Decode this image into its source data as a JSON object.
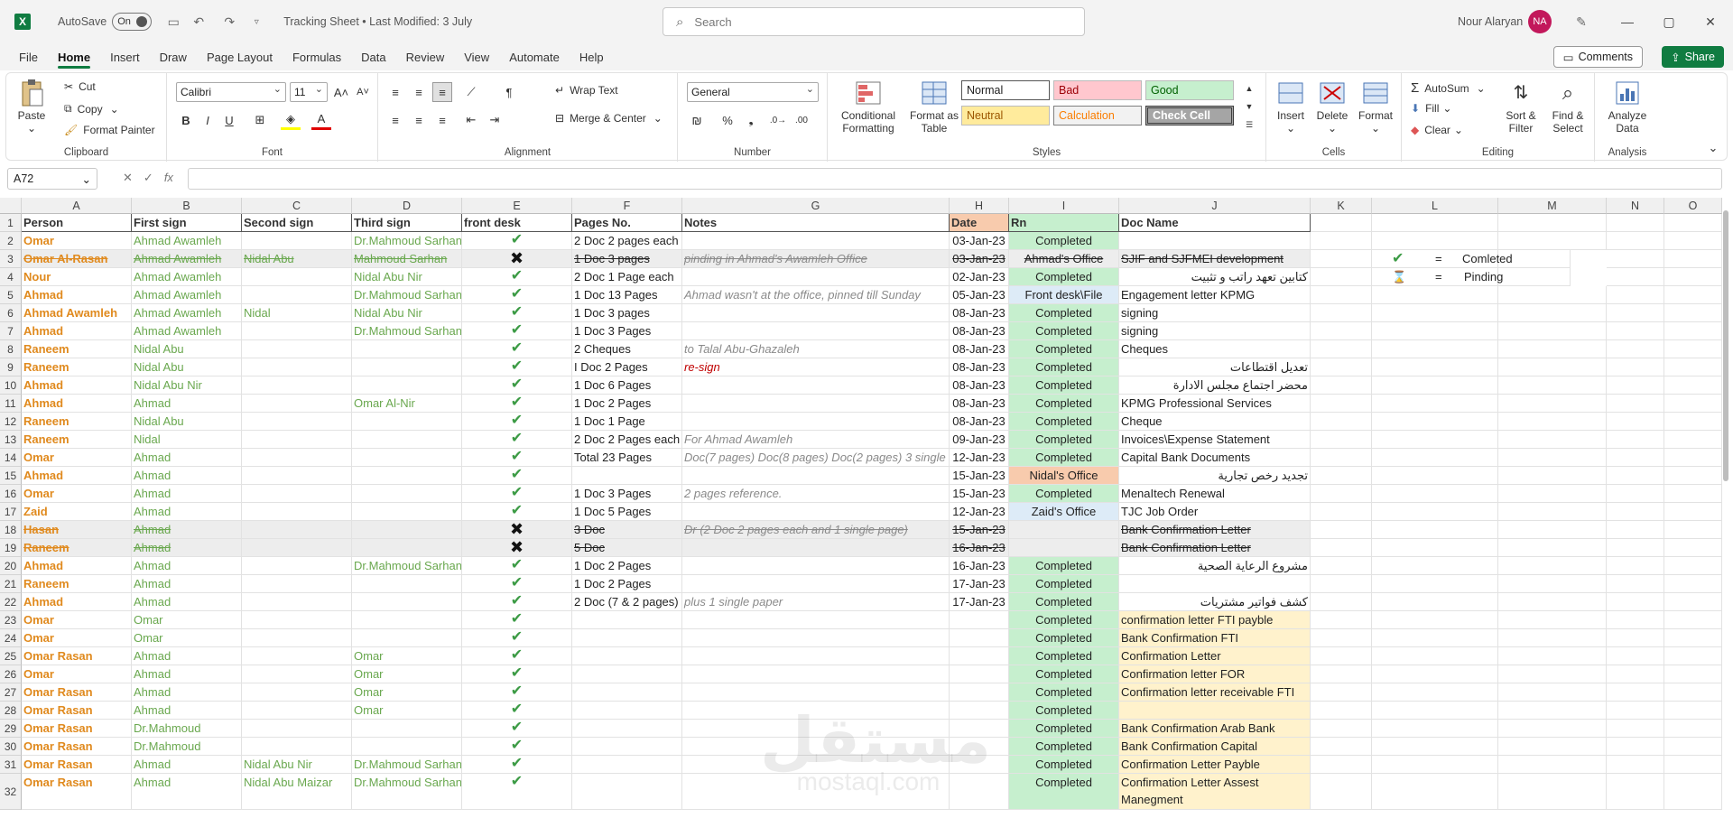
{
  "titlebar": {
    "autosave_label": "AutoSave",
    "autosave_state": "On",
    "doc_title": "Tracking Sheet • Last Modified: 3 July",
    "search_placeholder": "Search",
    "user_name": "Nour Alaryan",
    "user_initials": "NA"
  },
  "menu": {
    "tabs": [
      "File",
      "Home",
      "Insert",
      "Draw",
      "Page Layout",
      "Formulas",
      "Data",
      "Review",
      "View",
      "Automate",
      "Help"
    ],
    "comments": "Comments",
    "share": "Share"
  },
  "ribbon": {
    "clipboard": {
      "paste": "Paste",
      "cut": "Cut",
      "copy": "Copy",
      "format_painter": "Format Painter",
      "label": "Clipboard"
    },
    "font": {
      "name": "Calibri",
      "size": "11",
      "label": "Font"
    },
    "alignment": {
      "wrap": "Wrap Text",
      "merge": "Merge & Center",
      "label": "Alignment"
    },
    "number": {
      "format": "General",
      "label": "Number"
    },
    "styles": {
      "cond": "Conditional Formatting",
      "table": "Format as Table",
      "normal": "Normal",
      "bad": "Bad",
      "good": "Good",
      "neutral": "Neutral",
      "calculation": "Calculation",
      "check": "Check Cell",
      "label": "Styles"
    },
    "cells": {
      "insert": "Insert",
      "delete": "Delete",
      "format": "Format",
      "label": "Cells"
    },
    "editing": {
      "autosum": "AutoSum",
      "fill": "Fill",
      "clear": "Clear",
      "sort": "Sort & Filter",
      "find": "Find & Select",
      "label": "Editing"
    },
    "analysis": {
      "analyze": "Analyze Data",
      "label": "Analysis"
    }
  },
  "formula": {
    "namebox": "A72",
    "fx": "fx"
  },
  "columns": [
    "A",
    "B",
    "C",
    "D",
    "E",
    "F",
    "G",
    "H",
    "I",
    "J",
    "K",
    "L",
    "M",
    "N",
    "O"
  ],
  "headers": {
    "a": "Person",
    "b": "First sign",
    "c": "Second sign",
    "d": "Third sign",
    "e": "front desk",
    "f": "Pages No.",
    "g": "Notes",
    "h": "Date",
    "i": "Rn",
    "j": "Doc Name"
  },
  "legend": {
    "completed": "Comleted",
    "pending": "Pinding",
    "eq": "="
  },
  "rows": [
    {
      "n": "2",
      "a": "Omar",
      "b": "Ahmad Awamleh",
      "d": "Dr.Mahmoud Sarhan",
      "e": "check",
      "f": "2 Doc 2 pages each",
      "g": "",
      "h": "03-Jan-23",
      "i": "Completed",
      "j": ""
    },
    {
      "n": "3",
      "a": "Omar Al-Rasan",
      "b": "Ahmad Awamleh",
      "c": "Nidal Abu",
      "d": "Mahmoud Sarhan",
      "e": "x",
      "f": "1 Doc 3 pages",
      "g": "pinding in Ahmad's Awamleh Office",
      "h": "03-Jan-23",
      "i": "Ahmad's Office",
      "j": "SJIF and SJFMEI development",
      "strike": true
    },
    {
      "n": "4",
      "a": "Nour",
      "b": "Ahmad Awamleh",
      "d": "Nidal Abu Nir",
      "e": "check",
      "f": "2 Doc 1 Page each",
      "g": "",
      "h": "02-Jan-23",
      "i": "Completed",
      "j": "كتابين تعهد راتب و تثبيت"
    },
    {
      "n": "5",
      "a": "Ahmad",
      "b": "Ahmad Awamleh",
      "d": "Dr.Mahmoud Sarhan",
      "e": "check",
      "f": "1 Doc 13 Pages",
      "g": "Ahmad wasn't at the office, pinned till Sunday",
      "h": "05-Jan-23",
      "i": "Front desk\\File",
      "j": "Engagement letter KPMG"
    },
    {
      "n": "6",
      "a": "Ahmad Awamleh",
      "b": "Ahmad Awamleh",
      "c": "Nidal",
      "d": "Nidal Abu Nir",
      "e": "check",
      "f": "1 Doc 3 pages",
      "g": "",
      "h": "08-Jan-23",
      "i": "Completed",
      "j": "signing"
    },
    {
      "n": "7",
      "a": "Ahmad",
      "b": "Ahmad Awamleh",
      "d": "Dr.Mahmoud Sarhan",
      "e": "check",
      "f": "1 Doc 3 Pages",
      "g": "",
      "h": "08-Jan-23",
      "i": "Completed",
      "j": "signing"
    },
    {
      "n": "8",
      "a": "Raneem",
      "b": "Nidal Abu",
      "e": "check",
      "f": "2 Cheques",
      "g": " to Talal Abu-Ghazaleh",
      "h": "08-Jan-23",
      "i": "Completed",
      "j": "Cheques"
    },
    {
      "n": "9",
      "a": "Raneem",
      "b": "Nidal Abu",
      "e": "check",
      "f": "I Doc 2 Pages",
      "g": "re-sign",
      "gred": true,
      "h": "08-Jan-23",
      "i": "Completed",
      "j": "تعديل اقتطاعات"
    },
    {
      "n": "10",
      "a": "Ahmad",
      "b": "Nidal Abu Nir",
      "e": "check",
      "f": "1 Doc 6 Pages",
      "g": "",
      "h": "08-Jan-23",
      "i": "Completed",
      "j": "محضر اجتماع مجلس الادارة"
    },
    {
      "n": "11",
      "a": "Ahmad",
      "b": "Ahmad",
      "d": "Omar Al-Nir",
      "e": "check",
      "f": "1 Doc 2 Pages",
      "g": "",
      "h": "08-Jan-23",
      "i": "Completed",
      "j": "KPMG Professional Services"
    },
    {
      "n": "12",
      "a": "Raneem",
      "b": "Nidal Abu",
      "e": "check",
      "f": "1 Doc 1 Page",
      "g": "",
      "h": "08-Jan-23",
      "i": "Completed",
      "j": "Cheque"
    },
    {
      "n": "13",
      "a": "Raneem",
      "b": "Nidal",
      "e": "check",
      "f": "2 Doc 2 Pages each",
      "g": "For Ahmad Awamleh",
      "h": "09-Jan-23",
      "i": "Completed",
      "j": "Invoices\\Expense Statement"
    },
    {
      "n": "14",
      "a": "Omar",
      "b": "Ahmad",
      "e": "check",
      "f": "Total 23 Pages",
      "g": "Doc(7 pages) Doc(8 pages) Doc(2 pages) 3 single",
      "h": "12-Jan-23",
      "i": "Completed",
      "j": "Capital Bank Documents"
    },
    {
      "n": "15",
      "a": "Ahmad",
      "b": "Ahmad",
      "e": "check",
      "f": "",
      "g": "",
      "h": "15-Jan-23",
      "i": "Nidal's Office",
      "j": "تجديد رخص تجارية"
    },
    {
      "n": "16",
      "a": "Omar",
      "b": "Ahmad",
      "e": "check",
      "f": "1 Doc 3 Pages",
      "g": "2 pages reference.",
      "h": "15-Jan-23",
      "i": "Completed",
      "j": "MenaItech Renewal"
    },
    {
      "n": "17",
      "a": "Zaid",
      "b": "Ahmad",
      "e": "check",
      "f": "1 Doc 5 Pages",
      "g": "",
      "h": "12-Jan-23",
      "i": "Zaid's Office",
      "j": "TJC Job Order"
    },
    {
      "n": "18",
      "a": "Hasan",
      "b": "Ahmad",
      "e": "x",
      "f": "3 Doc",
      "g": "Dr (2 Doc 2 pages each and 1 single page)",
      "h": "15-Jan-23",
      "i": "",
      "j": "Bank Confirmation Letter",
      "strike": true
    },
    {
      "n": "19",
      "a": "Raneem",
      "b": "Ahmad",
      "e": "x",
      "f": "5 Doc",
      "g": "",
      "h": "16-Jan-23",
      "i": "",
      "j": "Bank Confirmation Letter",
      "strike": true
    },
    {
      "n": "20",
      "a": "Ahmad",
      "b": "Ahmad",
      "d": "Dr.Mahmoud Sarhan",
      "e": "check",
      "f": "1 Doc 2 Pages",
      "g": "",
      "h": "16-Jan-23",
      "i": "Completed",
      "j": "مشروع الرعاية الصحية"
    },
    {
      "n": "21",
      "a": "Raneem",
      "b": "Ahmad",
      "e": "check",
      "f": "1 Doc 2 Pages",
      "g": "",
      "h": "17-Jan-23",
      "i": "Completed",
      "j": ""
    },
    {
      "n": "22",
      "a": "Ahmad",
      "b": "Ahmad",
      "e": "check",
      "f": "2 Doc (7 & 2 pages)",
      "g": "plus 1 single paper",
      "h": "17-Jan-23",
      "i": "Completed",
      "j": "كشف فواتير مشتريات"
    },
    {
      "n": "23",
      "a": "Omar",
      "b": "Omar",
      "e": "check",
      "f": "",
      "g": "",
      "h": "",
      "i": "Completed",
      "j": "confirmation letter FTI payble",
      "jy": true
    },
    {
      "n": "24",
      "a": "Omar",
      "b": "Omar",
      "e": "check",
      "f": "",
      "g": "",
      "h": "",
      "i": "Completed",
      "j": "Bank Confirmation FTI",
      "jy": true
    },
    {
      "n": "25",
      "a": "Omar Rasan",
      "b": "Ahmad",
      "d": "Omar",
      "e": "check",
      "f": "",
      "g": "",
      "h": "",
      "i": "Completed",
      "j": "Confirmation Letter",
      "jy": true
    },
    {
      "n": "26",
      "a": "Omar",
      "b": "Ahmad",
      "d": "Omar",
      "e": "check",
      "f": "",
      "g": "",
      "h": "",
      "i": "Completed",
      "j": "Confirmation letter FOR",
      "jy": true
    },
    {
      "n": "27",
      "a": "Omar Rasan",
      "b": "Ahmad",
      "d": "Omar",
      "e": "check",
      "f": "",
      "g": "",
      "h": "",
      "i": "Completed",
      "j": "Confirmation letter receivable FTI",
      "jy": true
    },
    {
      "n": "28",
      "a": "Omar Rasan",
      "b": "Ahmad",
      "d": "Omar",
      "e": "check",
      "f": "",
      "g": "",
      "h": "",
      "i": "Completed",
      "j": "",
      "jy": true
    },
    {
      "n": "29",
      "a": "Omar Rasan",
      "b": "Dr.Mahmoud",
      "e": "check",
      "f": "",
      "g": "",
      "h": "",
      "i": "Completed",
      "j": "Bank Confirmation Arab Bank",
      "jy": true
    },
    {
      "n": "30",
      "a": "Omar Rasan",
      "b": "Dr.Mahmoud",
      "e": "check",
      "f": "",
      "g": "",
      "h": "",
      "i": "Completed",
      "j": "Bank Confirmation Capital",
      "jy": true
    },
    {
      "n": "31",
      "a": "Omar Rasan",
      "b": "Ahmad",
      "c": "Nidal Abu Nir",
      "d": "Dr.Mahmoud Sarhan",
      "e": "check",
      "f": "",
      "g": "",
      "h": "",
      "i": "Completed",
      "j": "Confirmation Letter Payble",
      "jy": true
    },
    {
      "n": "32",
      "a": "Omar Rasan",
      "b": "Ahmad",
      "c": "Nidal Abu Maizar",
      "d": "Dr.Mahmoud Sarhan",
      "e": "check",
      "f": "",
      "g": "",
      "h": "",
      "i": "Completed",
      "j": "Confirmation Letter Assest Manegment",
      "jy": true,
      "tall": true
    }
  ],
  "watermark": {
    "arabic": "مستقل",
    "latin": "mostaql.com"
  }
}
